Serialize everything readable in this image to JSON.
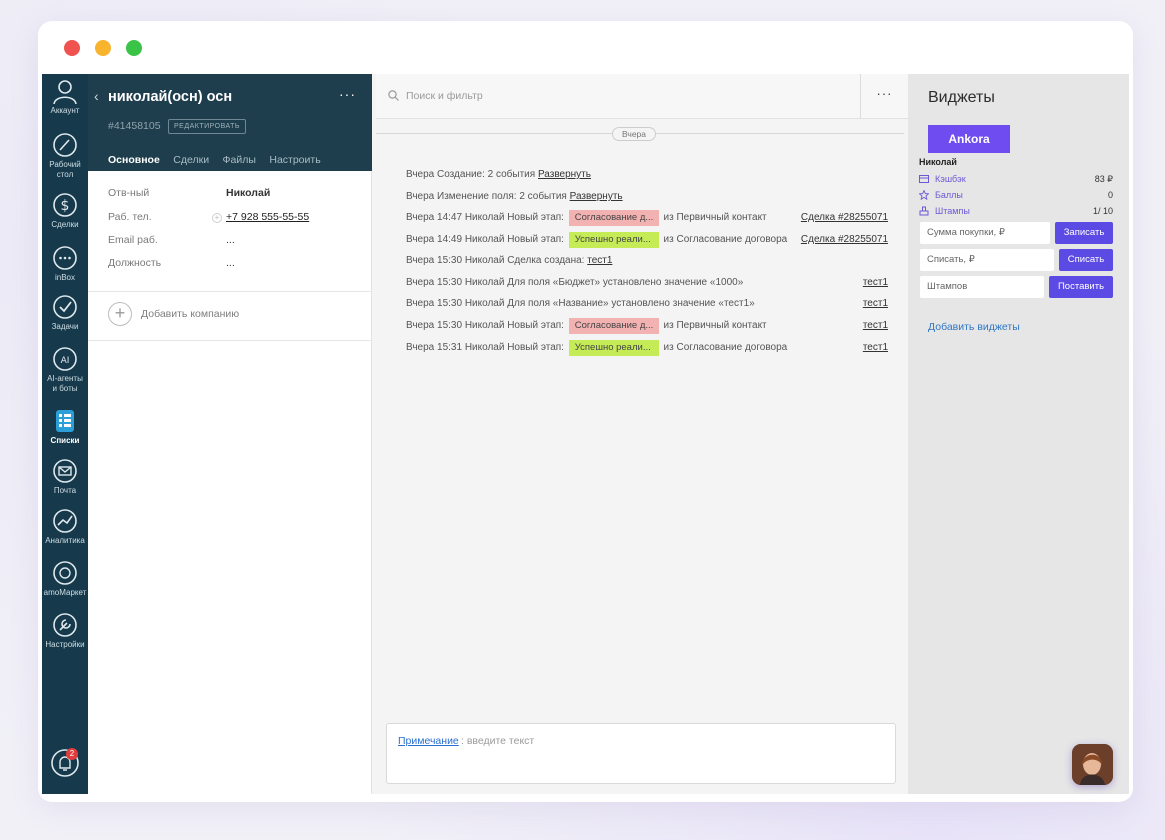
{
  "window": {
    "controls": [
      "close",
      "minimize",
      "maximize"
    ]
  },
  "nav": {
    "items": [
      {
        "label": "Аккаунт",
        "icon": "account-icon"
      },
      {
        "label": "Рабочий стол",
        "icon": "dashboard-icon"
      },
      {
        "label": "Сделки",
        "icon": "deals-icon"
      },
      {
        "label": "inBox",
        "icon": "inbox-icon"
      },
      {
        "label": "Задачи",
        "icon": "tasks-icon"
      },
      {
        "label": "AI-агенты и боты",
        "icon": "ai-agents-icon"
      },
      {
        "label": "Списки",
        "icon": "lists-icon",
        "active": true
      },
      {
        "label": "Почта",
        "icon": "mail-icon"
      },
      {
        "label": "Аналитика",
        "icon": "analytics-icon"
      },
      {
        "label": "amoМаркет",
        "icon": "market-icon"
      },
      {
        "label": "Настройки",
        "icon": "settings-icon"
      }
    ],
    "notifications_badge": "2"
  },
  "card": {
    "title": "николай(осн) осн",
    "more": "···",
    "id": "#41458105",
    "edit_label": "РЕДАКТИРОВАТЬ",
    "tabs": [
      "Основное",
      "Сделки",
      "Файлы",
      "Настроить"
    ],
    "fields": [
      {
        "label": "Отв-ный",
        "value": "Николай"
      },
      {
        "label": "Раб. тел.",
        "value": "+7 928 555-55-55"
      },
      {
        "label": "Email раб.",
        "value": "..."
      },
      {
        "label": "Должность",
        "value": "..."
      }
    ],
    "add_company": "Добавить компанию"
  },
  "feed": {
    "search_placeholder": "Поиск и фильтр",
    "more": "···",
    "day_label": "Вчера",
    "events": [
      {
        "text": "Вчера Создание: 2 события ",
        "link": "Развернуть"
      },
      {
        "text": "Вчера Изменение поля: 2 события ",
        "link": "Развернуть"
      },
      {
        "text": "Вчера 14:47 Николай Новый этап: ",
        "badge": "Согласование д...",
        "after": " из Первичный контакт",
        "right": "Сделка #28255071"
      },
      {
        "text": "Вчера 14:49 Николай Новый этап: ",
        "badge": "Успешно реали...",
        "after": " из Согласование договора",
        "right": "Сделка #28255071"
      },
      {
        "text": "Вчера 15:30 Николай Сделка создана: ",
        "link": "тест1"
      },
      {
        "text": "Вчера 15:30 Николай Для поля «Бюджет» установлено значение «1000»",
        "right": "тест1"
      },
      {
        "text": "Вчера 15:30 Николай Для поля «Название» установлено значение «тест1»",
        "right": "тест1"
      },
      {
        "text": "Вчера 15:30 Николай Новый этап: ",
        "badge": "Согласование д...",
        "after": " из Первичный контакт",
        "right": "тест1"
      },
      {
        "text": "Вчера 15:31 Николай Новый этап: ",
        "badge": "Успешно реали...",
        "after": " из Согласование договора",
        "right": "тест1"
      }
    ],
    "note_label": "Примечание",
    "note_placeholder": ": введите текст"
  },
  "widgets": {
    "title": "Виджеты",
    "brand": "Ankora",
    "client_name": "Николай",
    "rows": [
      {
        "label": "Кэшбэк",
        "value": "83 ₽",
        "icon": "card-icon"
      },
      {
        "label": "Баллы",
        "value": "0",
        "icon": "star-icon"
      },
      {
        "label": "Штампы",
        "value": "1/ 10",
        "icon": "stamp-icon"
      }
    ],
    "forms": [
      {
        "placeholder": "Сумма покупки, ₽",
        "button": "Записать"
      },
      {
        "placeholder": "Списать, ₽",
        "button": "Списать"
      },
      {
        "placeholder": "Штампов",
        "button": "Поставить"
      }
    ],
    "add_link": "Добавить виджеты"
  },
  "colors": {
    "nav_bg": "#163a4c",
    "card_head_bg": "#1f3e4d",
    "accent": "#6f4cf0",
    "badge_pink": "#f3b2b2",
    "badge_green": "#c5ec56",
    "link": "#2f77c7"
  }
}
